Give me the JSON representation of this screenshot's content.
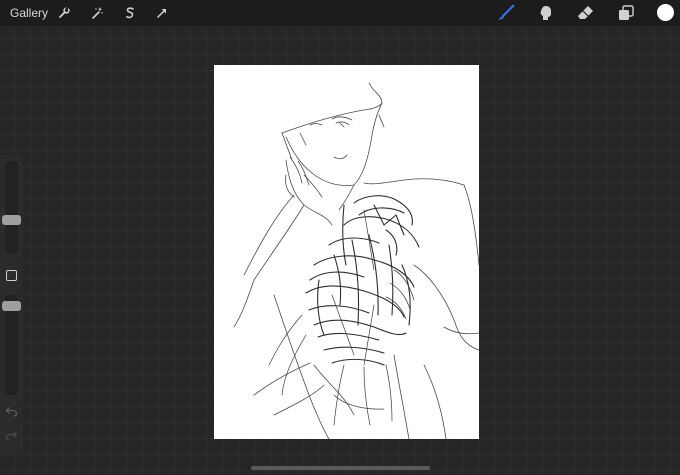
{
  "toolbar": {
    "gallery_label": "Gallery",
    "left_tools": [
      "wrench-icon",
      "magic-wand-icon",
      "selection-s-icon",
      "transform-arrow-icon"
    ],
    "right_tools": [
      "brush-icon",
      "smudge-icon",
      "eraser-icon",
      "layers-icon"
    ],
    "active_tool": "brush",
    "active_color": "#3d6fe0",
    "current_color": "#ffffff"
  },
  "sidebar": {
    "brush_size_level": 0.35,
    "opacity_level": 0.9,
    "controls": [
      "brush-size-slider",
      "modify-button",
      "opacity-slider",
      "undo-icon",
      "redo-icon"
    ]
  },
  "canvas": {
    "background": "#ffffff",
    "content": "sketch-drawing"
  }
}
